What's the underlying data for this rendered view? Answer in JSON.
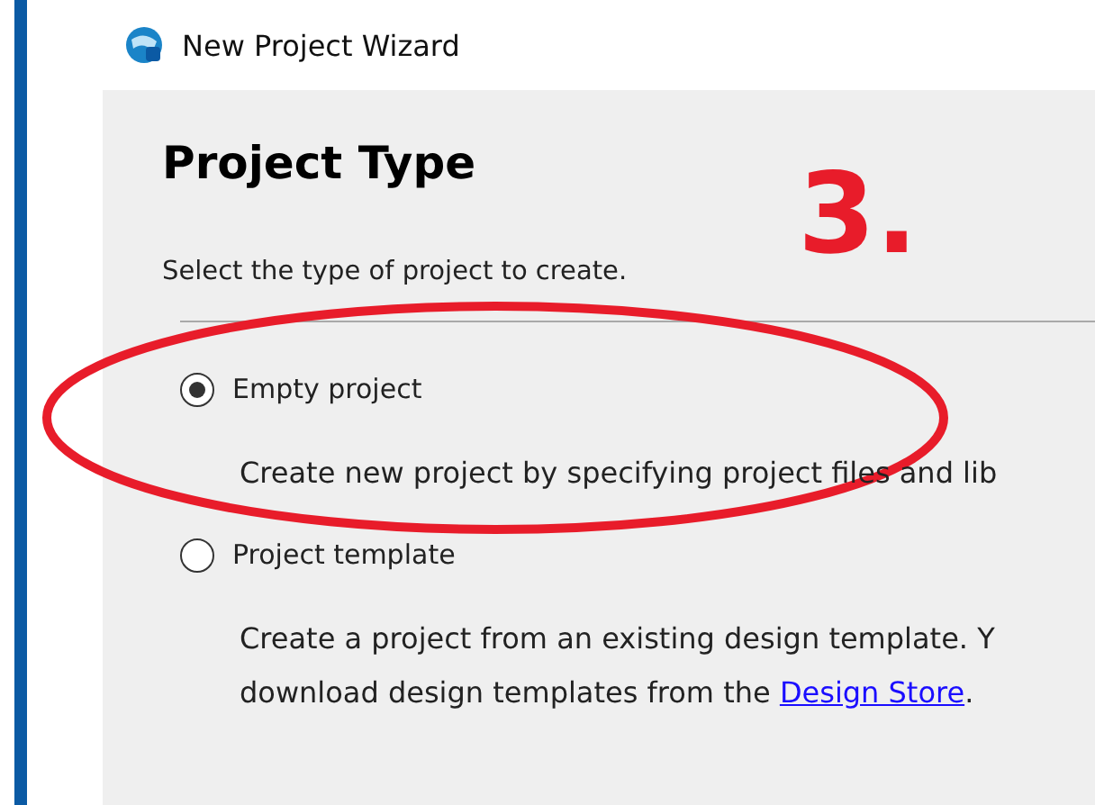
{
  "window": {
    "title": "New Project Wizard"
  },
  "page": {
    "heading": "Project Type",
    "instruction": "Select the type of project to create."
  },
  "options": [
    {
      "label": "Empty project",
      "selected": true,
      "description": [
        [
          {
            "kind": "text",
            "text": "Create new project by specifying project files and lib"
          }
        ]
      ]
    },
    {
      "label": "Project template",
      "selected": false,
      "description": [
        [
          {
            "kind": "text",
            "text": "Create a project from an existing design template. Y"
          }
        ],
        [
          {
            "kind": "text",
            "text": "download design templates from the "
          },
          {
            "kind": "link",
            "text": "Design Store"
          },
          {
            "kind": "text",
            "text": "."
          }
        ]
      ]
    }
  ],
  "annotation": {
    "label": "3."
  }
}
